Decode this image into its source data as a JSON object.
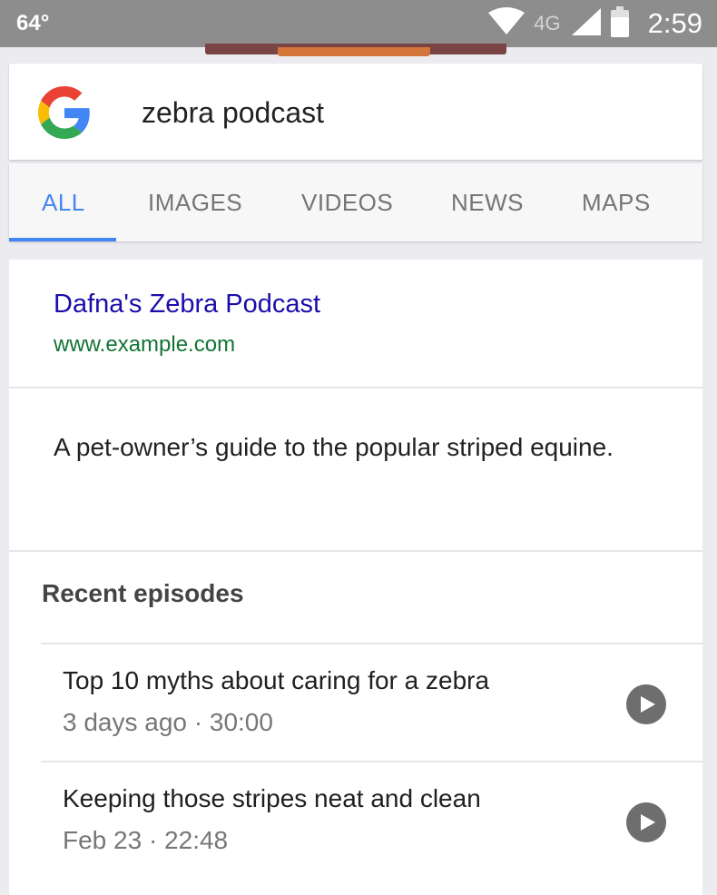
{
  "status_bar": {
    "temperature": "64°",
    "network": "4G",
    "time": "2:59",
    "icons": [
      "wifi-icon",
      "cell-signal-icon",
      "battery-icon"
    ]
  },
  "search": {
    "logo_icon": "google-g-logo",
    "query": "zebra podcast"
  },
  "tabs": [
    {
      "label": "ALL",
      "active": true
    },
    {
      "label": "IMAGES",
      "active": false
    },
    {
      "label": "VIDEOS",
      "active": false
    },
    {
      "label": "NEWS",
      "active": false
    },
    {
      "label": "MAPS",
      "active": false
    }
  ],
  "result": {
    "title": "Dafna's Zebra Podcast",
    "url": "www.example.com",
    "description": "A pet-owner’s guide to the popular striped equine.",
    "recent_heading": "Recent episodes",
    "episodes": [
      {
        "title": "Top 10 myths about caring for a zebra",
        "meta": "3 days ago · 30:00",
        "action_icon": "play-icon"
      },
      {
        "title": "Keeping those stripes neat and clean",
        "meta": "Feb 23 · 22:48",
        "action_icon": "play-icon"
      }
    ]
  },
  "colors": {
    "accent": "#4285f4",
    "link": "#1a0dab",
    "url": "#137333",
    "status_bar": "#8d8d8d"
  }
}
